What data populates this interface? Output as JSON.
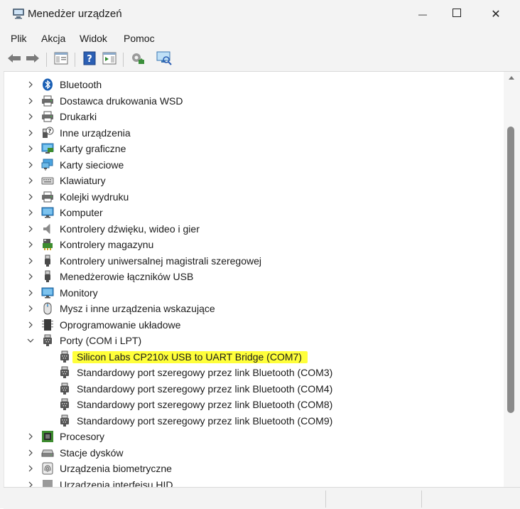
{
  "window": {
    "title": "Menedżer urządzeń",
    "minimize_glyph": "—",
    "maximize_glyph": "☐",
    "close_glyph": "✕"
  },
  "menu": [
    "Plik",
    "Akcja",
    "Widok",
    "Pomoc"
  ],
  "toolbar": {
    "buttons": [
      "back-arrow-icon",
      "forward-arrow-icon",
      "properties-pane-icon",
      "help-icon",
      "action-pane-icon",
      "update-driver-icon",
      "scan-hardware-icon"
    ]
  },
  "tree": {
    "items": [
      {
        "label": "Bluetooth",
        "icon": "bluetooth-icon",
        "expanded": false
      },
      {
        "label": "Dostawca drukowania WSD",
        "icon": "printer-icon",
        "expanded": false
      },
      {
        "label": "Drukarki",
        "icon": "printer-icon",
        "expanded": false
      },
      {
        "label": "Inne urządzenia",
        "icon": "unknown-device-icon",
        "expanded": false
      },
      {
        "label": "Karty graficzne",
        "icon": "display-adapter-icon",
        "expanded": false
      },
      {
        "label": "Karty sieciowe",
        "icon": "network-adapter-icon",
        "expanded": false
      },
      {
        "label": "Klawiatury",
        "icon": "keyboard-icon",
        "expanded": false
      },
      {
        "label": "Kolejki wydruku",
        "icon": "printer-icon",
        "expanded": false
      },
      {
        "label": "Komputer",
        "icon": "monitor-icon",
        "expanded": false
      },
      {
        "label": "Kontrolery dźwięku, wideo i gier",
        "icon": "speaker-icon",
        "expanded": false
      },
      {
        "label": "Kontrolery magazynu",
        "icon": "storage-controller-icon",
        "expanded": false
      },
      {
        "label": "Kontrolery uniwersalnej magistrali szeregowej",
        "icon": "usb-icon",
        "expanded": false
      },
      {
        "label": "Menedżerowie łączników USB",
        "icon": "usb-icon",
        "expanded": false
      },
      {
        "label": "Monitory",
        "icon": "monitor-icon",
        "expanded": false
      },
      {
        "label": "Mysz i inne urządzenia wskazujące",
        "icon": "mouse-icon",
        "expanded": false
      },
      {
        "label": "Oprogramowanie układowe",
        "icon": "firmware-icon",
        "expanded": false
      },
      {
        "label": "Porty (COM i LPT)",
        "icon": "port-icon",
        "expanded": true
      },
      {
        "label": "Silicon Labs CP210x USB to UART Bridge (COM7)",
        "icon": "port-icon",
        "child": true,
        "highlighted": true
      },
      {
        "label": "Standardowy port szeregowy przez link Bluetooth (COM3)",
        "icon": "port-icon",
        "child": true
      },
      {
        "label": "Standardowy port szeregowy przez link Bluetooth (COM4)",
        "icon": "port-icon",
        "child": true
      },
      {
        "label": "Standardowy port szeregowy przez link Bluetooth (COM8)",
        "icon": "port-icon",
        "child": true
      },
      {
        "label": "Standardowy port szeregowy przez link Bluetooth (COM9)",
        "icon": "port-icon",
        "child": true
      },
      {
        "label": "Procesory",
        "icon": "processor-icon",
        "expanded": false
      },
      {
        "label": "Stacje dysków",
        "icon": "disk-drive-icon",
        "expanded": false
      },
      {
        "label": "Urządzenia biometryczne",
        "icon": "fingerprint-icon",
        "expanded": false
      },
      {
        "label": "Urządzenia interfejsu HID",
        "icon": "hid-icon",
        "expanded": false
      }
    ]
  },
  "colors": {
    "highlight": "#ffff3a",
    "accent": "#0067c0",
    "chrome": "#f3f3f3"
  }
}
